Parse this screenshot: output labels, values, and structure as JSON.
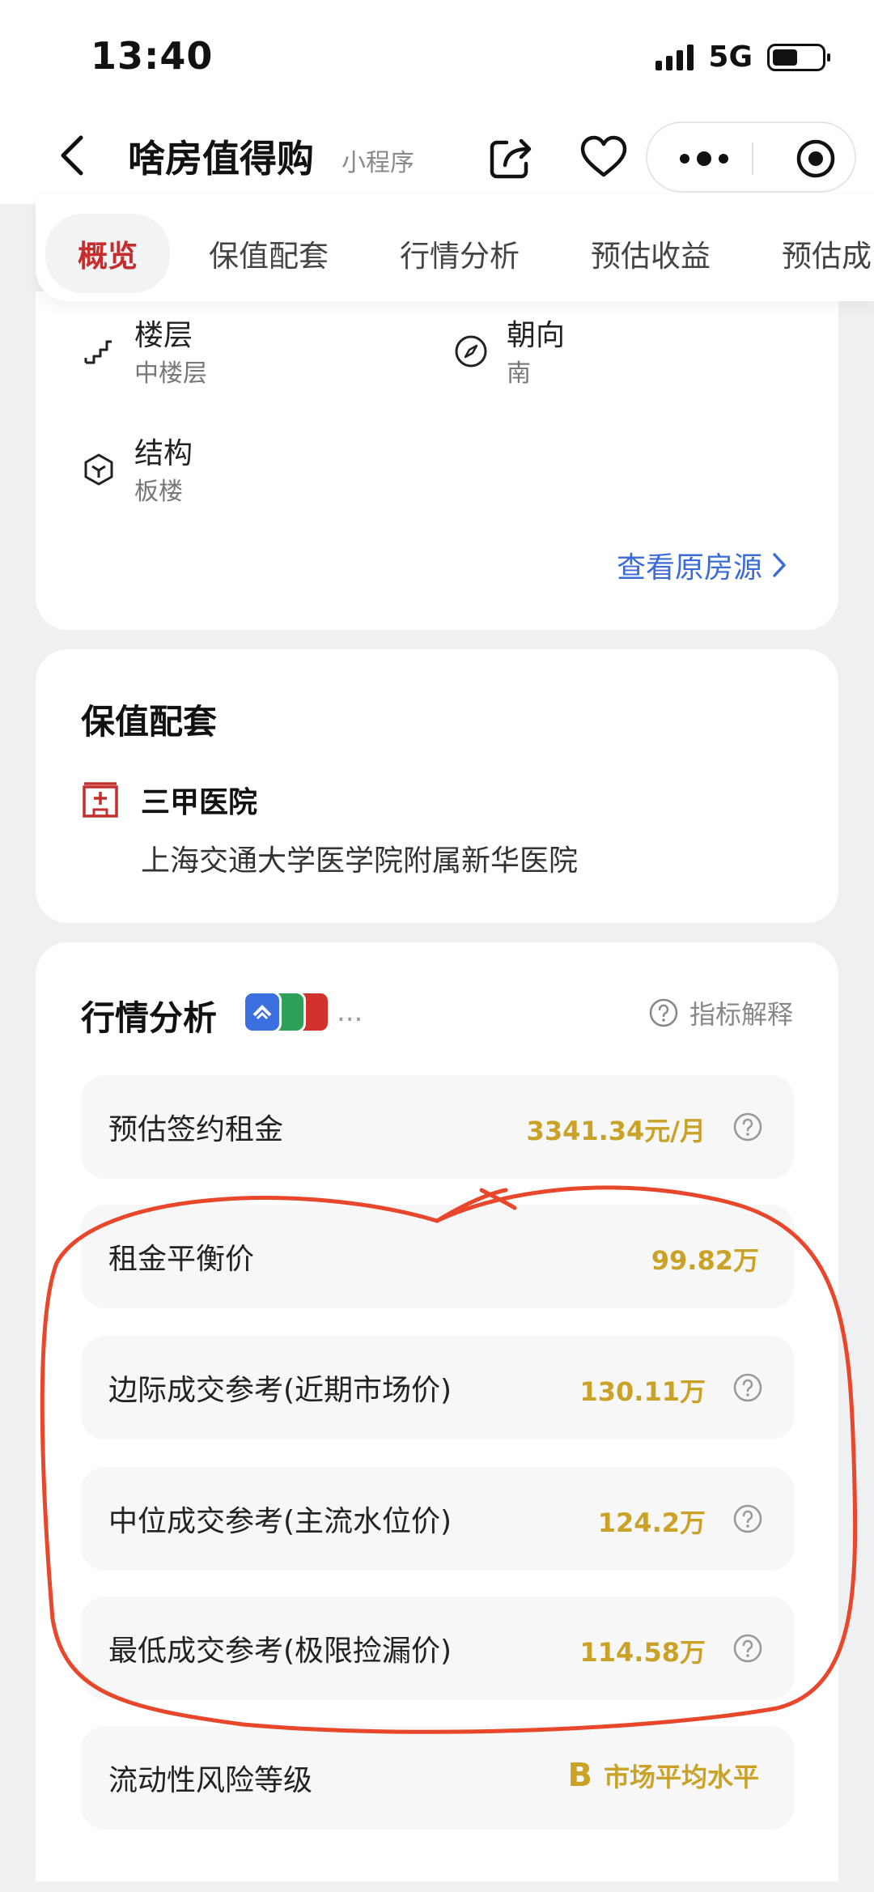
{
  "status_bar": {
    "time": "13:40",
    "network": "5G"
  },
  "nav": {
    "title": "啥房值得购",
    "subtitle": "小程序"
  },
  "tabs": [
    {
      "label": "概览"
    },
    {
      "label": "保值配套"
    },
    {
      "label": "行情分析"
    },
    {
      "label": "预估收益"
    },
    {
      "label": "预估成"
    }
  ],
  "property": {
    "floor_label": "楼层",
    "floor_value": "中楼层",
    "orientation_label": "朝向",
    "orientation_value": "南",
    "structure_label": "结构",
    "structure_value": "板楼",
    "view_source": "查看原房源"
  },
  "amenities": {
    "title": "保值配套",
    "hospital_type": "三甲医院",
    "hospital_name": "上海交通大学医学院附属新华医院"
  },
  "market": {
    "title": "行情分析",
    "explain": "指标解释",
    "more": "...",
    "rows": [
      {
        "label": "预估签约租金",
        "value": "3341.34元/月"
      },
      {
        "label": "租金平衡价",
        "value": "99.82万"
      },
      {
        "label": "边际成交参考(近期市场价)",
        "value": "130.11万"
      },
      {
        "label": "中位成交参考(主流水位价)",
        "value": "124.2万"
      },
      {
        "label": "最低成交参考(极限捡漏价)",
        "value": "114.58万"
      }
    ],
    "liquidity": {
      "label": "流动性风险等级",
      "grade": "B",
      "desc": "市场平均水平"
    }
  },
  "colors": {
    "accent_red": "#c52e2e",
    "value_gold": "#c9a227",
    "link_blue": "#3a6bd6",
    "annotation_red": "#e8472c"
  }
}
